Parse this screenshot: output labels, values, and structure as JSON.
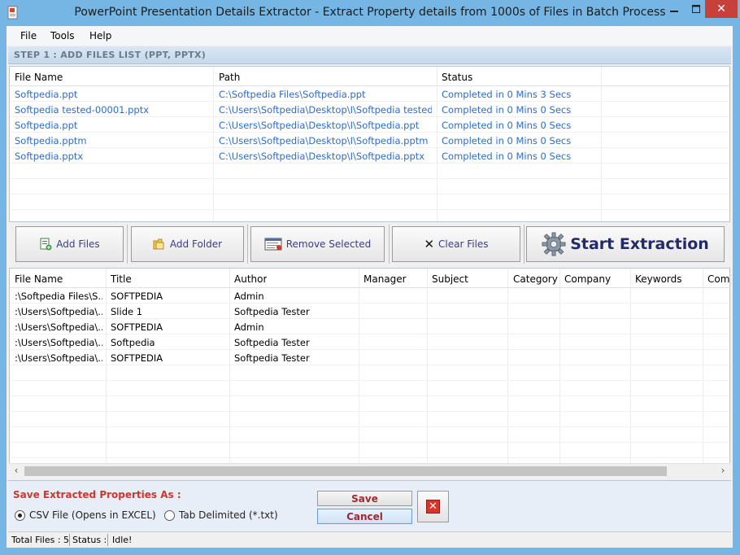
{
  "window": {
    "title": "PowerPoint Presentation Details Extractor - Extract Property details from 1000s of Files in Batch Process",
    "accent": "#75b6e4"
  },
  "menu": {
    "items": [
      "File",
      "Tools",
      "Help"
    ]
  },
  "step1": {
    "label": "STEP 1 : ADD FILES LIST (PPT, PPTX)"
  },
  "files_table": {
    "headers": [
      "File Name",
      "Path",
      "Status"
    ],
    "rows": [
      [
        "Softpedia.ppt",
        "C:\\Softpedia Files\\Softpedia.ppt",
        "Completed in 0 Mins 3 Secs"
      ],
      [
        "Softpedia tested-00001.pptx",
        "C:\\Users\\Softpedia\\Desktop\\I\\Softpedia tested-...",
        "Completed in 0 Mins 0 Secs"
      ],
      [
        "Softpedia.ppt",
        "C:\\Users\\Softpedia\\Desktop\\I\\Softpedia.ppt",
        "Completed in 0 Mins 0 Secs"
      ],
      [
        "Softpedia.pptm",
        "C:\\Users\\Softpedia\\Desktop\\I\\Softpedia.pptm",
        "Completed in 0 Mins 0 Secs"
      ],
      [
        "Softpedia.pptx",
        "C:\\Users\\Softpedia\\Desktop\\I\\Softpedia.pptx",
        "Completed in 0 Mins 0 Secs"
      ]
    ]
  },
  "toolbar": {
    "add_files": "Add Files",
    "add_folder": "Add Folder",
    "remove_selected": "Remove Selected",
    "clear_files": "Clear Files",
    "start_extraction": "Start Extraction"
  },
  "props_table": {
    "headers": [
      "File Name",
      "Title",
      "Author",
      "Manager",
      "Subject",
      "Category",
      "Company",
      "Keywords",
      "Com"
    ],
    "rows": [
      [
        ":\\Softpedia Files\\S...",
        "SOFTPEDIA",
        "Admin",
        "",
        "",
        "",
        "",
        "",
        ""
      ],
      [
        ":\\Users\\Softpedia\\...",
        "Slide 1",
        "Softpedia Tester",
        "",
        "",
        "",
        "",
        "",
        ""
      ],
      [
        ":\\Users\\Softpedia\\...",
        "SOFTPEDIA",
        "Admin",
        "",
        "",
        "",
        "",
        "",
        ""
      ],
      [
        ":\\Users\\Softpedia\\...",
        "Softpedia",
        "Softpedia Tester",
        "",
        "",
        "",
        "",
        "",
        ""
      ],
      [
        ":\\Users\\Softpedia\\...",
        "SOFTPEDIA",
        "Softpedia Tester",
        "",
        "",
        "",
        "",
        "",
        ""
      ]
    ]
  },
  "save_panel": {
    "title": "Save Extracted Properties As :",
    "option_csv": "CSV File (Opens in EXCEL)",
    "option_tab": "Tab Delimited (*.txt)",
    "selected": "csv",
    "save": "Save",
    "cancel": "Cancel"
  },
  "statusbar": {
    "total_files": "Total Files : 5",
    "status_label": "Status :",
    "status_value": "Idle!"
  },
  "icons": {
    "app": "powerpoint-doc-icon",
    "add_files": "add-files-icon",
    "add_folder": "folder-icon",
    "remove_selected": "remove-list-icon",
    "clear_files": "clear-x-icon",
    "start": "gear-icon",
    "exit": "close-icon"
  }
}
